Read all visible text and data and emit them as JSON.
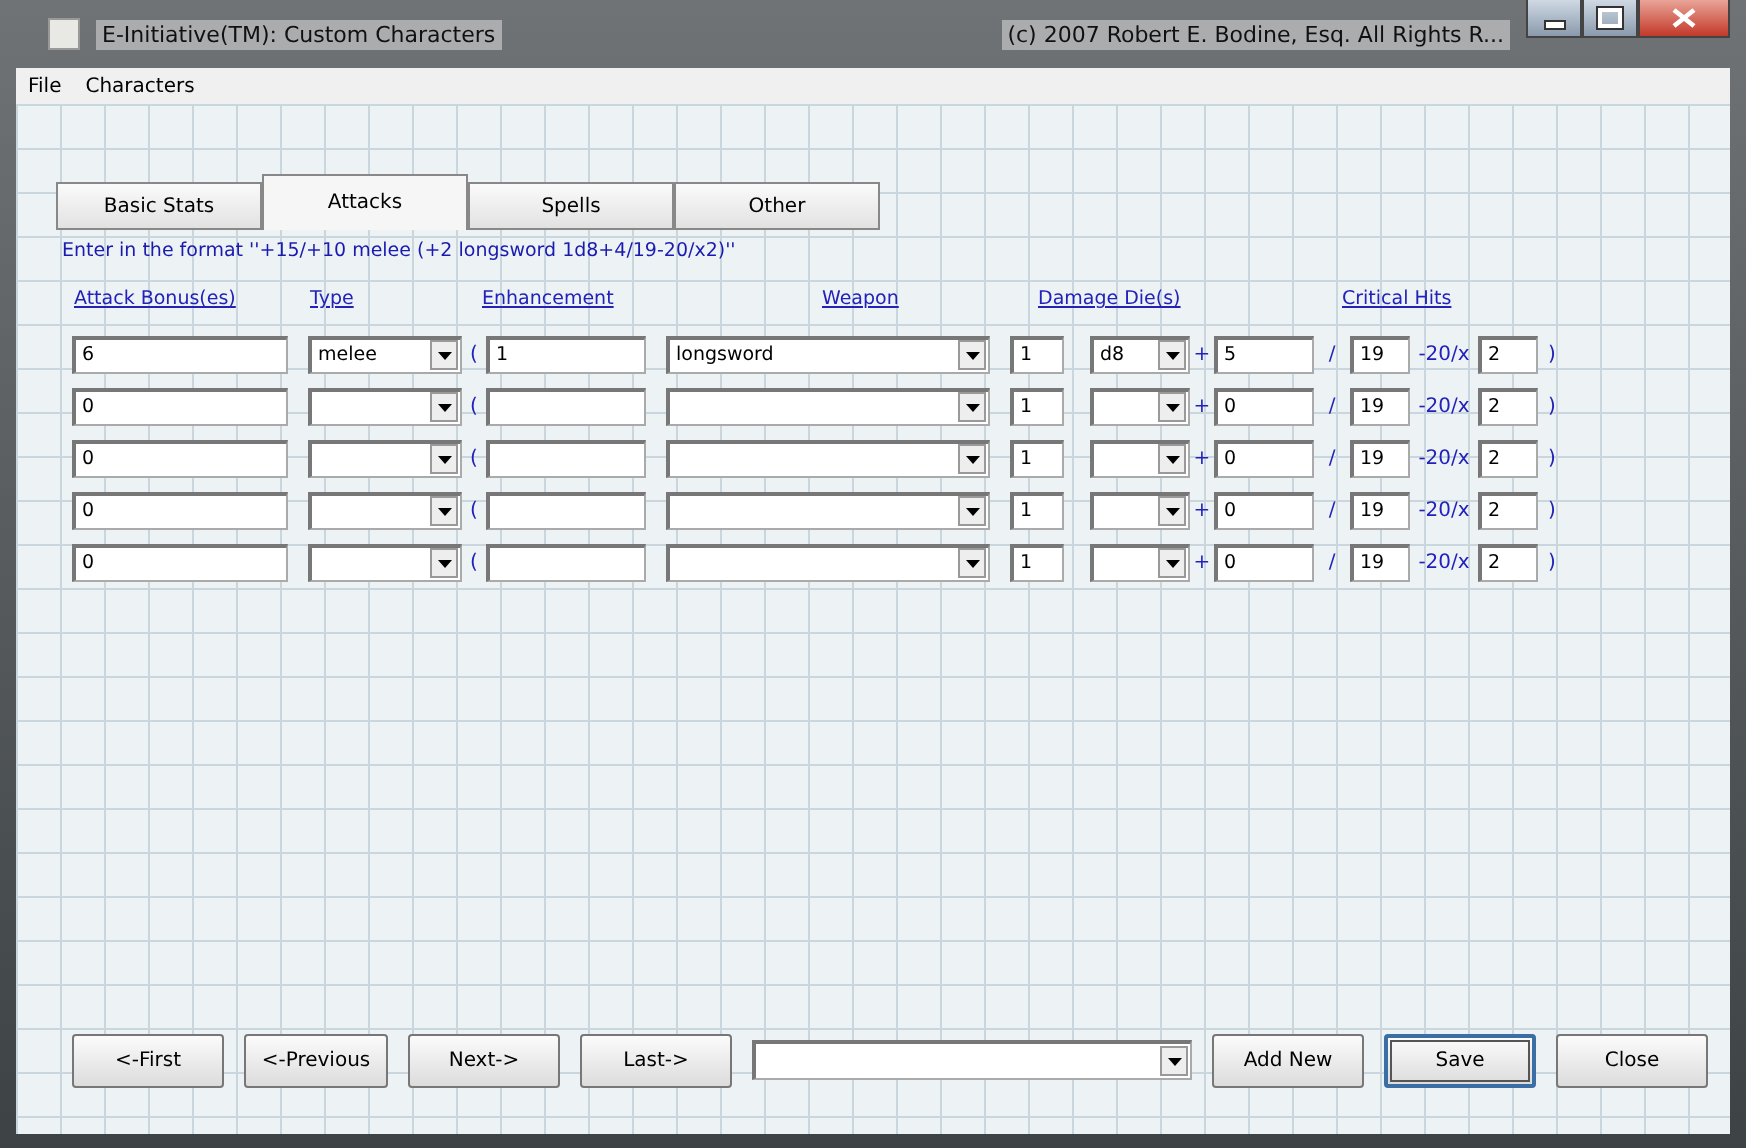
{
  "window": {
    "title": "E-Initiative(TM): Custom Characters",
    "caption_right": "(c) 2007 Robert E. Bodine, Esq. All Rights R..."
  },
  "menu": [
    "File",
    "Characters"
  ],
  "tabs": [
    {
      "label": "Basic Stats",
      "selected": false
    },
    {
      "label": "Attacks",
      "selected": true
    },
    {
      "label": "Spells",
      "selected": false
    },
    {
      "label": "Other",
      "selected": false
    }
  ],
  "hint": "Enter in the format ''+15/+10 melee (+2 longsword 1d8+4/19-20/x2)''",
  "columns": [
    "Attack Bonus(es)",
    "Type",
    "Enhancement",
    "Weapon",
    "Damage Die(s)",
    "Critical Hits"
  ],
  "rows": [
    {
      "attack_bonus": "6",
      "type": "melee",
      "open": "(",
      "enhancement": "1",
      "weapon": "longsword",
      "dice": "1",
      "die": "d8",
      "plus": "+",
      "bonus": "5",
      "slash": "/",
      "threat": "19",
      "range": "-20/x",
      "multiplier": "2",
      "close": ")"
    },
    {
      "attack_bonus": "0",
      "open": "(",
      "dice": "1",
      "plus": "+",
      "bonus": "0",
      "slash": "/",
      "threat": "19",
      "range": "-20/x",
      "multiplier": "2",
      "close": ")"
    },
    {
      "attack_bonus": "0",
      "open": "(",
      "dice": "1",
      "plus": "+",
      "bonus": "0",
      "slash": "/",
      "threat": "19",
      "range": "-20/x",
      "multiplier": "2",
      "close": ")"
    },
    {
      "attack_bonus": "0",
      "open": "(",
      "dice": "1",
      "plus": "+",
      "bonus": "0",
      "slash": "/",
      "threat": "19",
      "range": "-20/x",
      "multiplier": "2",
      "close": ")"
    },
    {
      "attack_bonus": "0",
      "open": "(",
      "dice": "1",
      "plus": "+",
      "bonus": "0",
      "slash": "/",
      "threat": "19",
      "range": "-20/x",
      "multiplier": "2",
      "close": ")"
    }
  ],
  "buttons": [
    {
      "label": "<-First",
      "kind": "nav"
    },
    {
      "label": "<-Previous",
      "kind": "nav"
    },
    {
      "label": "Next->",
      "kind": "nav"
    },
    {
      "label": "Last->",
      "kind": "nav"
    },
    {
      "kind": "combo"
    },
    {
      "label": "Add New",
      "kind": "action"
    },
    {
      "label": "Save",
      "kind": "default"
    },
    {
      "label": "Close",
      "kind": "action"
    }
  ]
}
